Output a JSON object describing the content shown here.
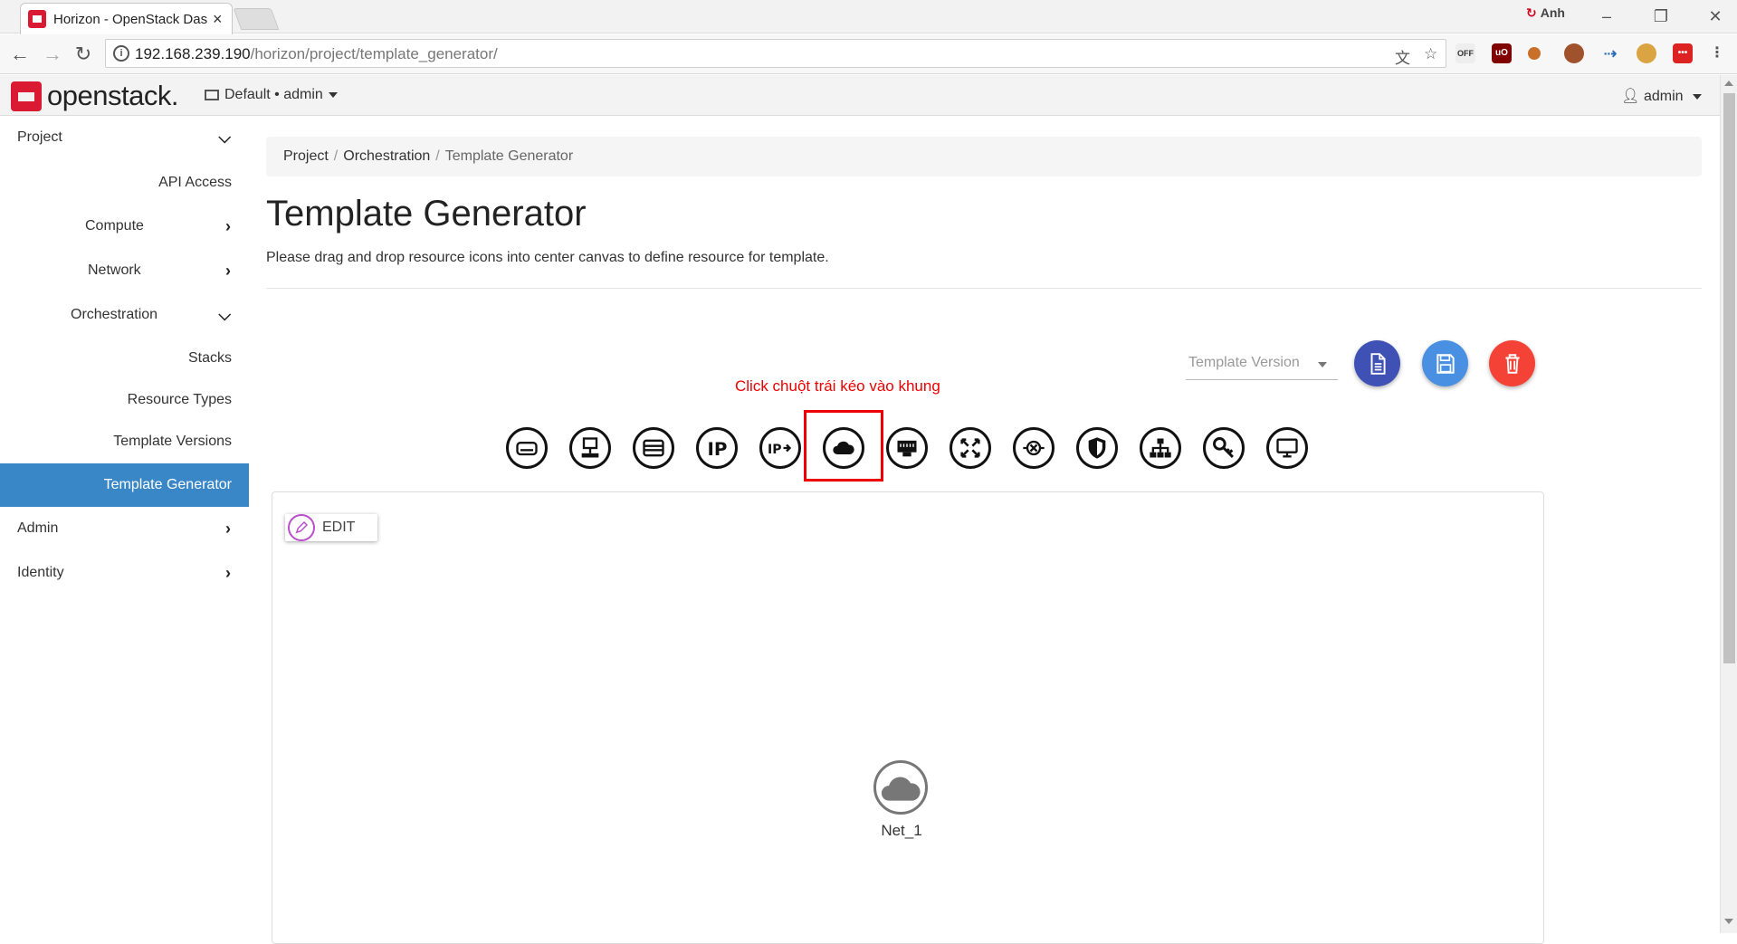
{
  "browser": {
    "tab_title": "Horizon - OpenStack Das",
    "tab_close": "×",
    "profile_name": "Anh",
    "url_host": "192.168.239.190",
    "url_path": "/horizon/project/template_generator/",
    "extension_off_label": "OFF"
  },
  "navbar": {
    "logo_text": "openstack.",
    "project_selector": "Default • admin",
    "user": "admin"
  },
  "sidebar": {
    "items": [
      {
        "label": "Project"
      },
      {
        "label": "API Access"
      },
      {
        "label": "Compute"
      },
      {
        "label": "Network"
      },
      {
        "label": "Orchestration"
      },
      {
        "label": "Stacks"
      },
      {
        "label": "Resource Types"
      },
      {
        "label": "Template Versions"
      },
      {
        "label": "Template Generator"
      },
      {
        "label": "Admin"
      },
      {
        "label": "Identity"
      }
    ]
  },
  "breadcrumb": {
    "items": [
      "Project",
      "Orchestration",
      "Template Generator"
    ],
    "separator": "/"
  },
  "page": {
    "title": "Template Generator",
    "description": "Please drag and drop resource icons into center canvas to define resource for template."
  },
  "toolbar": {
    "template_version_placeholder": "Template Version"
  },
  "hint": "Click chuột trái kéo vào khung",
  "palette_icons": [
    "volume-icon",
    "server-group-icon",
    "server-icon",
    "floating-ip-icon",
    "floating-ip-association-icon",
    "network-icon",
    "port-icon",
    "router-icon",
    "router-interface-icon",
    "security-group-icon",
    "subnet-icon",
    "keypair-icon",
    "instance-icon"
  ],
  "canvas": {
    "edit_label": "EDIT",
    "node_label": "Net_1"
  },
  "colors": {
    "accent_blue": "#3a87c8",
    "fab_indigo": "#3f51b5",
    "fab_blue": "#4a90e2",
    "fab_red": "#f44336",
    "hint_red": "#e00000",
    "brand_red": "#da1a32"
  }
}
